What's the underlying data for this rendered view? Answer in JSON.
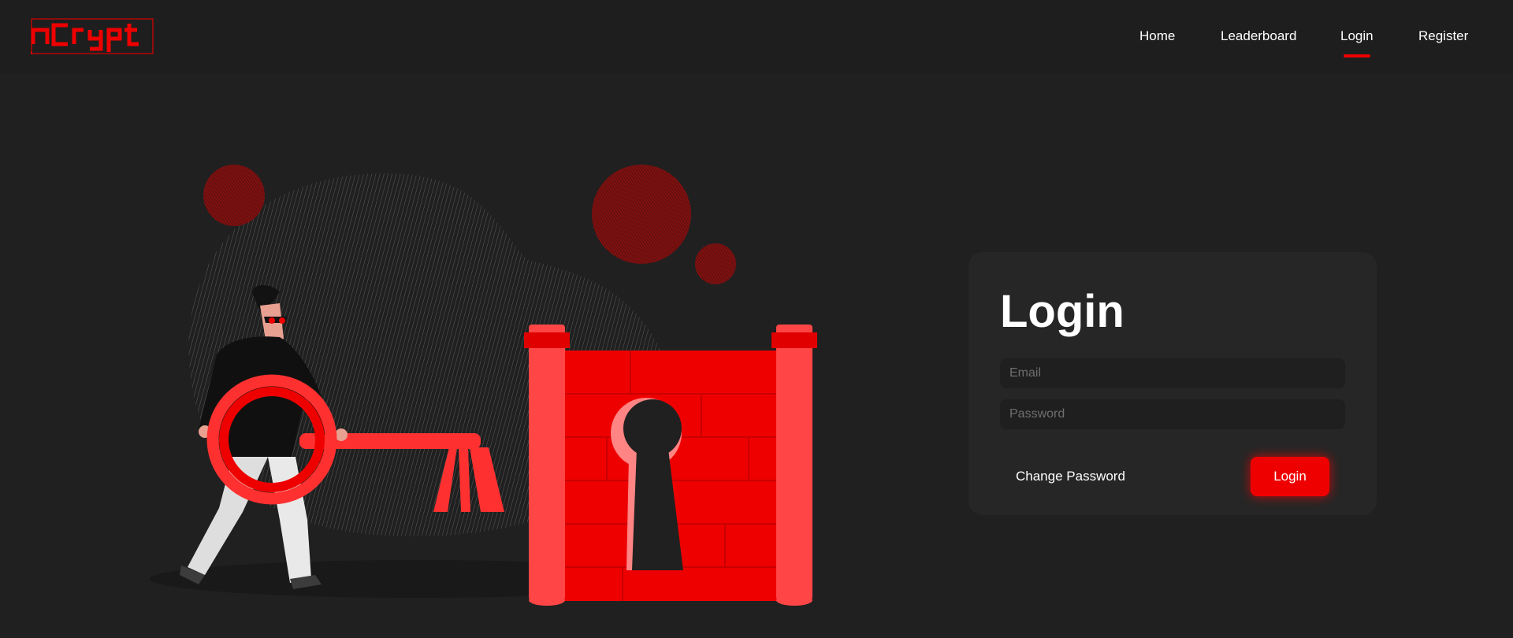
{
  "brand": {
    "name": "nCrypt"
  },
  "nav": {
    "items": [
      {
        "label": "Home"
      },
      {
        "label": "Leaderboard"
      },
      {
        "label": "Login",
        "active": true
      },
      {
        "label": "Register"
      }
    ]
  },
  "login_card": {
    "title": "Login",
    "email_placeholder": "Email",
    "password_placeholder": "Password",
    "change_password_label": "Change Password",
    "login_button_label": "Login"
  },
  "colors": {
    "background": "#202020",
    "navbar": "#1e1e1e",
    "card": "#262626",
    "accent": "#ee0000"
  }
}
